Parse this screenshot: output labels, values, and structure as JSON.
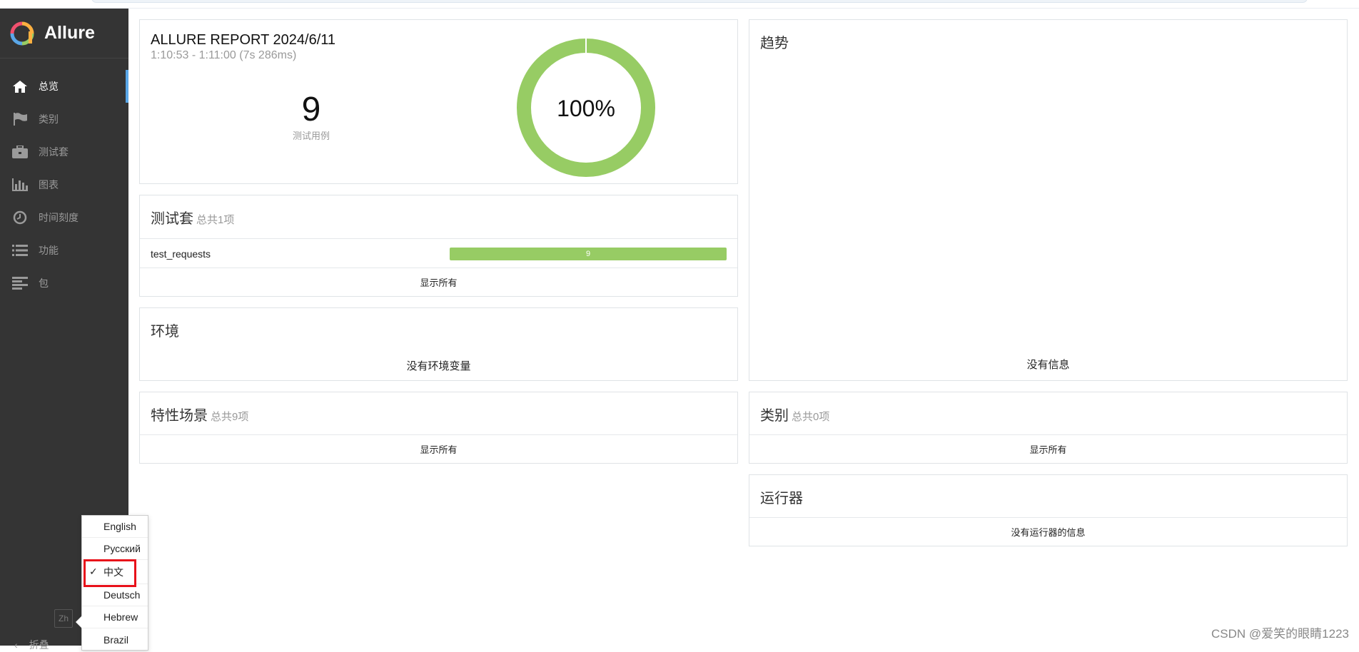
{
  "app": {
    "name": "Allure"
  },
  "sidebar": {
    "items": [
      {
        "label": "总览",
        "icon": "home-icon",
        "active": true
      },
      {
        "label": "类别",
        "icon": "flag-icon",
        "active": false
      },
      {
        "label": "测试套",
        "icon": "briefcase-icon",
        "active": false
      },
      {
        "label": "图表",
        "icon": "bar-chart-icon",
        "active": false
      },
      {
        "label": "时间刻度",
        "icon": "clock-icon",
        "active": false
      },
      {
        "label": "功能",
        "icon": "list-icon",
        "active": false
      },
      {
        "label": "包",
        "icon": "align-left-icon",
        "active": false
      }
    ],
    "language_button": "Zh",
    "collapse_label": "折叠"
  },
  "language_menu": {
    "options": [
      "English",
      "Русский",
      "中文",
      "Deutsch",
      "Hebrew",
      "Brazil"
    ],
    "selected": "中文",
    "check": "✓"
  },
  "summary": {
    "title": "ALLURE REPORT 2024/6/11",
    "time": "1:10:53 - 1:11:00 (7s 286ms)",
    "count": "9",
    "count_label": "测试用例",
    "percent_label": "100%",
    "passed_ratio": 1.0,
    "pass_color": "#97cc64"
  },
  "suites": {
    "title": "测试套",
    "subtitle": "总共1项",
    "rows": [
      {
        "name": "test_requests",
        "count": "9"
      }
    ],
    "show_all": "显示所有"
  },
  "environment": {
    "title": "环境",
    "empty": "没有环境变量"
  },
  "features": {
    "title": "特性场景",
    "subtitle": "总共9项",
    "show_all": "显示所有"
  },
  "trend": {
    "title": "趋势",
    "empty": "没有信息"
  },
  "categories": {
    "title": "类别",
    "subtitle": "总共0项",
    "show_all": "显示所有"
  },
  "executors": {
    "title": "运行器",
    "empty": "没有运行器的信息"
  },
  "watermark": "CSDN @爱笑的眼睛1223"
}
